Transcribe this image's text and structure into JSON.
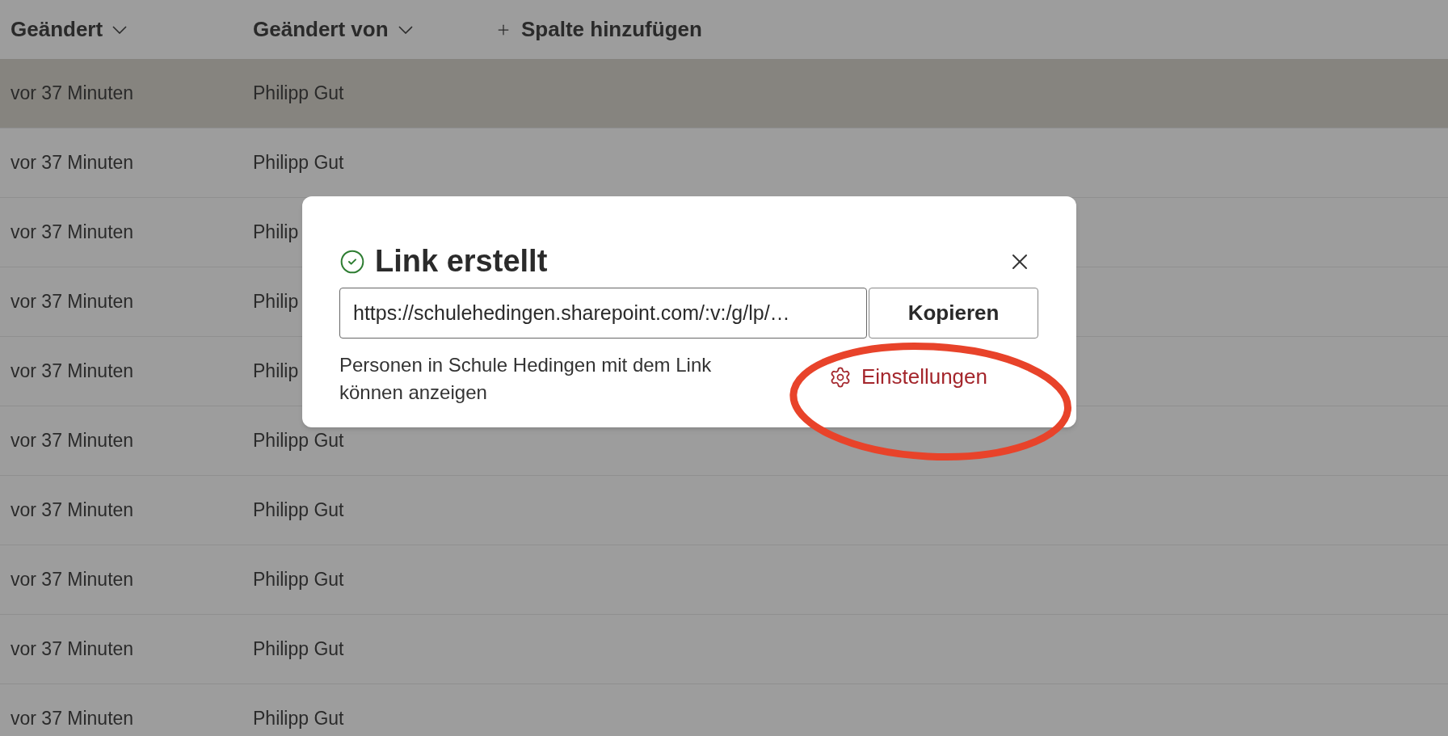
{
  "table": {
    "columns": [
      {
        "label": "Geändert",
        "kind": "sortable"
      },
      {
        "label": "Geändert von",
        "kind": "sortable"
      },
      {
        "label": "Spalte hinzufügen",
        "kind": "add"
      }
    ],
    "rows": [
      {
        "modified": "vor 37 Minuten",
        "modified_by": "Philipp Gut",
        "selected": true
      },
      {
        "modified": "vor 37 Minuten",
        "modified_by": "Philipp Gut",
        "selected": false
      },
      {
        "modified": "vor 37 Minuten",
        "modified_by": "Philip",
        "selected": false
      },
      {
        "modified": "vor 37 Minuten",
        "modified_by": "Philip",
        "selected": false
      },
      {
        "modified": "vor 37 Minuten",
        "modified_by": "Philip",
        "selected": false
      },
      {
        "modified": "vor 37 Minuten",
        "modified_by": "Philipp Gut",
        "selected": false
      },
      {
        "modified": "vor 37 Minuten",
        "modified_by": "Philipp Gut",
        "selected": false
      },
      {
        "modified": "vor 37 Minuten",
        "modified_by": "Philipp Gut",
        "selected": false
      },
      {
        "modified": "vor 37 Minuten",
        "modified_by": "Philipp Gut",
        "selected": false
      },
      {
        "modified": "vor 37 Minuten",
        "modified_by": "Philipp Gut",
        "selected": false
      }
    ]
  },
  "dialog": {
    "title": "Link erstellt",
    "link": "https://schulehedingen.sharepoint.com/:v:/g/lp/…",
    "copy_button": "Kopieren",
    "description": "Personen in Schule Hedingen mit dem Link können anzeigen",
    "settings_link": "Einstellungen"
  }
}
